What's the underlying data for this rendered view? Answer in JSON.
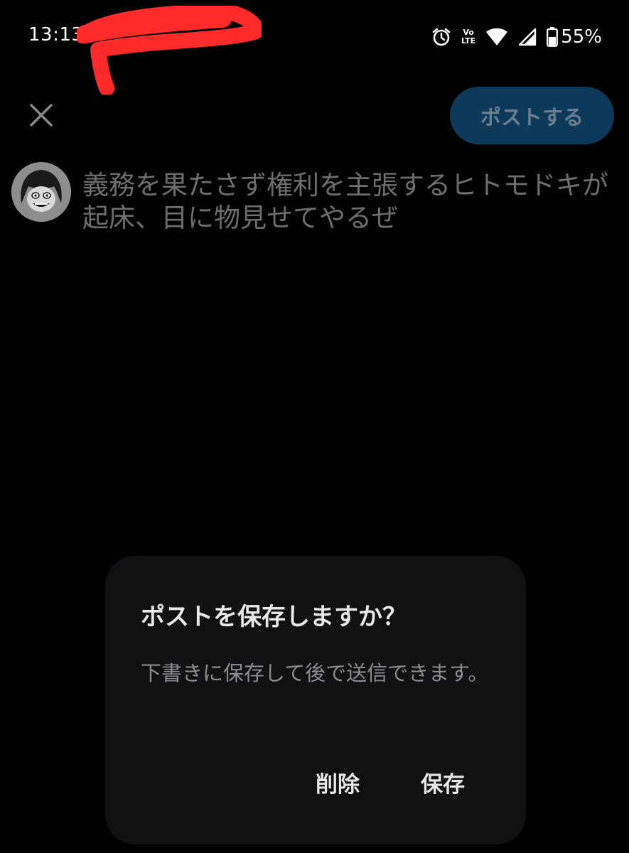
{
  "status_bar": {
    "time": "13:13",
    "volte_top": "Vo",
    "volte_bottom": "LTE",
    "battery_percent": "55%",
    "battery_level": 0.55
  },
  "composer": {
    "post_button_label": "ポストする",
    "draft_text": "義務を果たさず権利を主張するヒトモドキが起床、目に物見せてやるぜ"
  },
  "dialog": {
    "title": "ポストを保存しますか？",
    "message": "下書きに保存して後で送信できます。",
    "delete_label": "削除",
    "save_label": "保存"
  },
  "colors": {
    "background": "#000000",
    "post_button_bg": "#0d3a5a",
    "post_button_text": "#6b7f8f",
    "dialog_bg": "#101113",
    "redaction": "#ff2a2a"
  },
  "icons": {
    "close": "close-icon",
    "alarm": "alarm-icon",
    "wifi": "wifi-icon",
    "signal": "signal-icon",
    "battery": "battery-icon"
  }
}
